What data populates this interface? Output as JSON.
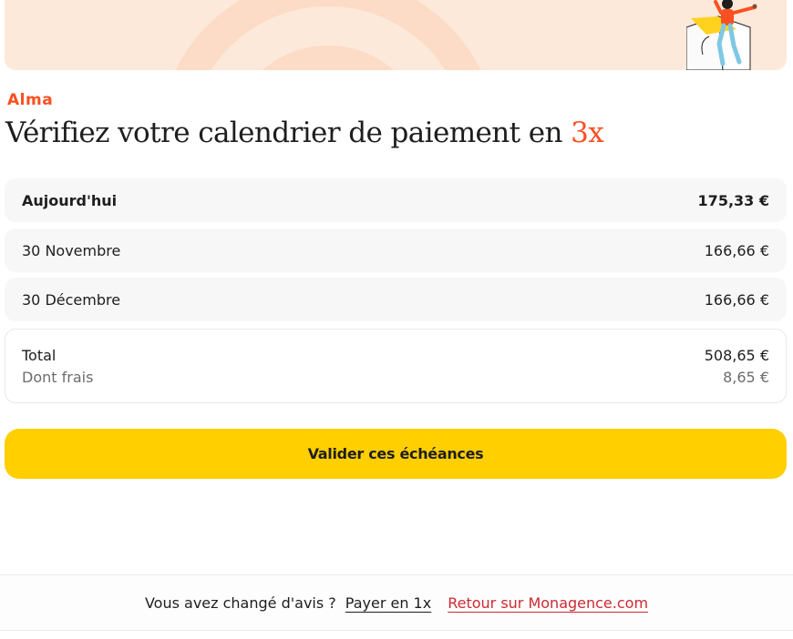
{
  "brand": {
    "name": "Alma",
    "color": "#fa5022"
  },
  "title": {
    "prefix": "Vérifiez votre calendrier de paiement en ",
    "installments": "3x"
  },
  "schedule": [
    {
      "label": "Aujourd'hui",
      "amount": "175,33 €"
    },
    {
      "label": "30 Novembre",
      "amount": "166,66 €"
    },
    {
      "label": "30 Décembre",
      "amount": "166,66 €"
    }
  ],
  "summary": {
    "total_label": "Total",
    "total_value": "508,65 €",
    "fees_label": "Dont frais",
    "fees_value": "8,65 €"
  },
  "cta": {
    "label": "Valider ces échéances",
    "color": "#ffcf00"
  },
  "footer": {
    "question": "Vous avez changé d'avis ?",
    "pay_once_link": "Payer en 1x",
    "return_link": "Retour sur Monagence.com"
  }
}
